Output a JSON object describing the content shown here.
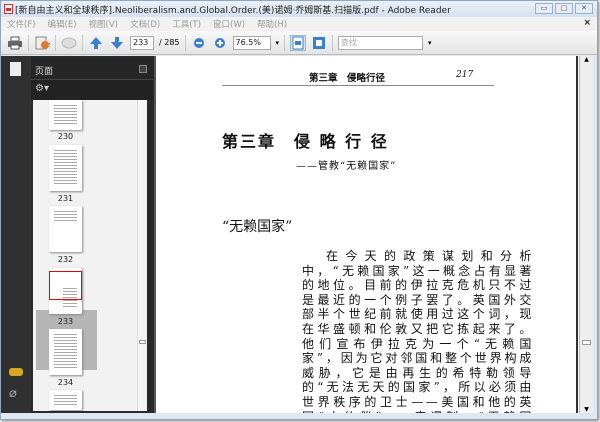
{
  "window": {
    "title": "[新自由主义和全球秩序].Neoliberalism.and.Global.Order.(美)诺姆·乔姆斯基.扫描版.pdf - Adobe Reader",
    "min": "▭",
    "max": "□",
    "close": "✕"
  },
  "menu": [
    "文件(F)",
    "编辑(E)",
    "视图(V)",
    "文档(D)",
    "工具(T)",
    "窗口(W)",
    "帮助(H)"
  ],
  "menu_close": "×",
  "toolbar": {
    "page_current": "233",
    "page_total": "/ 285",
    "zoom": "76.5%",
    "search_placeholder": "查找"
  },
  "nav": {
    "panel_title": "页面",
    "thumbnails": [
      {
        "label": "230"
      },
      {
        "label": "231"
      },
      {
        "label": "232"
      },
      {
        "label": "233",
        "selected": true
      },
      {
        "label": "234"
      }
    ]
  },
  "page": {
    "running_head": "第三章　侵略行径",
    "page_number": "217",
    "chapter_title": "第三章　侵 略 行 径",
    "subtitle": "——管教“无赖国家”",
    "section": "“无赖国家”",
    "paragraph": "在今天的政策谋划和分析中，“无赖国家”这一概念占有显著的地位。目前的伊拉克危机只不过是最近的一个例子罢了。英国外交部半个世纪前就使用过这个词，现在华盛顿和伦敦又把它拣起来了。他们宣布伊拉克为一个“无赖国家”，因为它对邻国和整个世界构成威胁，它是由再生的希特勒领导的“无法无天的国家”，所以必须由世界秩序的卫士——美国和他的英国“小伙伴”——来遏制。“无赖国家”这一概"
  }
}
